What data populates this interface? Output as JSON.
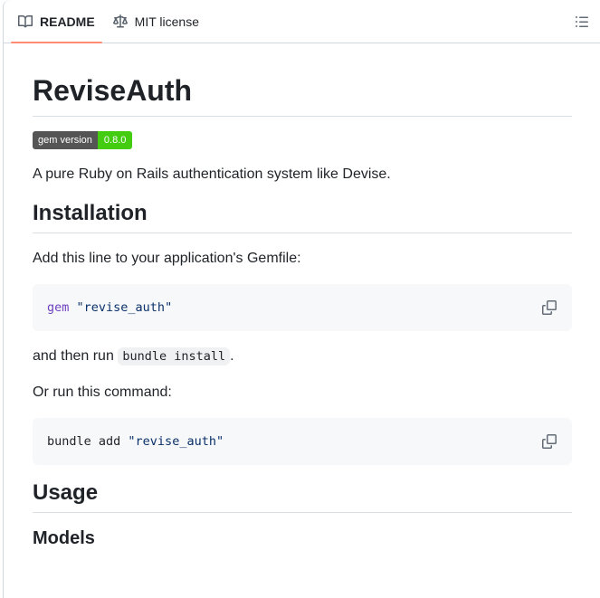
{
  "header": {
    "tabs": [
      {
        "label": "README",
        "icon": "book-icon",
        "active": true
      },
      {
        "label": "MIT license",
        "icon": "law-icon",
        "active": false
      }
    ],
    "outline_button": "outline"
  },
  "content": {
    "title": "ReviseAuth",
    "badge": {
      "label": "gem version",
      "value": "0.8.0",
      "label_bg": "#555555",
      "value_bg": "#44cc11"
    },
    "intro": "A pure Ruby on Rails authentication system like Devise.",
    "installation": {
      "heading": "Installation",
      "gemfile_para": "Add this line to your application's Gemfile:",
      "code_block_1": {
        "keyword": "gem",
        "string": "\"revise_auth\""
      },
      "run_prefix": "and then run",
      "run_inline_code": "bundle install",
      "run_suffix": ".",
      "or_para": "Or run this command:",
      "code_block_2": {
        "plain": "bundle add",
        "string": "\"revise_auth\""
      }
    },
    "usage": {
      "heading": "Usage",
      "models_heading": "Models"
    }
  },
  "colors": {
    "active_tab_underline": "#fd8c73",
    "border": "#d0d7de",
    "code_block_bg": "#f6f8fa",
    "syntax_keyword": "#6f42c1",
    "syntax_string": "#0a3069",
    "icon_gray": "#636c76"
  }
}
